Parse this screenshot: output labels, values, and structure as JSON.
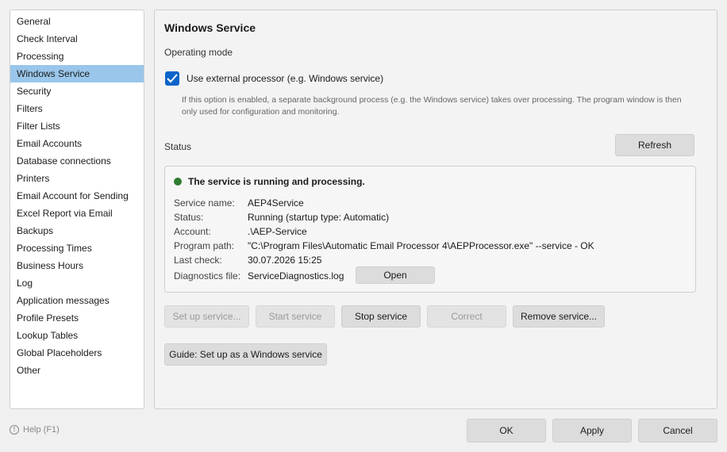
{
  "sidebar": {
    "items": [
      {
        "label": "General"
      },
      {
        "label": "Check Interval"
      },
      {
        "label": "Processing"
      },
      {
        "label": "Windows Service",
        "active": true
      },
      {
        "label": "Security"
      },
      {
        "label": "Filters"
      },
      {
        "label": "Filter Lists"
      },
      {
        "label": "Email Accounts"
      },
      {
        "label": "Database connections"
      },
      {
        "label": "Printers"
      },
      {
        "label": "Email Account for Sending"
      },
      {
        "label": "Excel Report via Email"
      },
      {
        "label": "Backups"
      },
      {
        "label": "Processing Times"
      },
      {
        "label": "Business Hours"
      },
      {
        "label": "Log"
      },
      {
        "label": "Application messages"
      },
      {
        "label": "Profile Presets"
      },
      {
        "label": "Lookup Tables"
      },
      {
        "label": "Global Placeholders"
      },
      {
        "label": "Other"
      }
    ]
  },
  "panel": {
    "title": "Windows Service",
    "operating_mode_label": "Operating mode",
    "use_external_label": "Use external processor (e.g. Windows service)",
    "use_external_checked": true,
    "hint": "If this option is enabled, a separate background process (e.g. the Windows service) takes over processing. The program window is then only used for configuration and monitoring.",
    "status_label": "Status",
    "refresh_label": "Refresh",
    "status_color": "#2e7d32",
    "status_text": "The service is running and processing.",
    "service_name_key": "Service name:",
    "service_name_val": "AEP4Service",
    "status_key": "Status:",
    "status_val": "Running (startup type: Automatic)",
    "account_key": "Account:",
    "account_val": ".\\AEP-Service",
    "path_key": "Program path:",
    "path_val": "\"C:\\Program Files\\Automatic Email Processor 4\\AEPProcessor.exe\" --service - OK",
    "lastcheck_key": "Last check:",
    "lastcheck_val": "30.07.2026 15:25",
    "diag_key": "Diagnostics file:",
    "diag_val": "ServiceDiagnostics.log",
    "open_label": "Open",
    "setup_label": "Set up service...",
    "start_label": "Start service",
    "stop_label": "Stop service",
    "correct_label": "Correct",
    "remove_label": "Remove service...",
    "guide_label": "Guide: Set up as a Windows service"
  },
  "footer": {
    "help_label": "Help (F1)",
    "ok_label": "OK",
    "apply_label": "Apply",
    "cancel_label": "Cancel"
  }
}
